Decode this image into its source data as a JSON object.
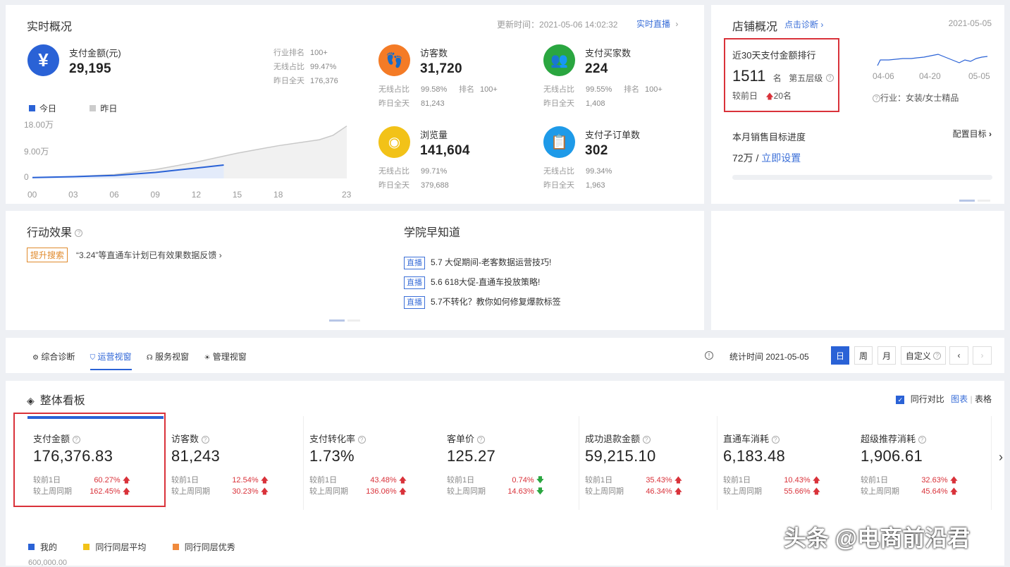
{
  "realtime": {
    "title": "实时概况",
    "updated_label": "更新时间：",
    "updated_time": "2021-05-06 14:02:32",
    "live_link": "实时直播",
    "pay_amount": {
      "label": "支付金额(元)",
      "value": "29,195"
    },
    "stats": [
      {
        "label": "行业排名",
        "value": "100+"
      },
      {
        "label": "无线占比",
        "value": "99.47%"
      },
      {
        "label": "昨日全天",
        "value": "176,376"
      }
    ],
    "legend": {
      "today": "今日",
      "yesterday": "昨日"
    },
    "chart_data": {
      "type": "area",
      "y_ticks": [
        "18.00万",
        "9.00万",
        "0"
      ],
      "x_ticks": [
        "00",
        "03",
        "06",
        "09",
        "12",
        "15",
        "18",
        "23"
      ],
      "series": [
        {
          "name": "今日",
          "x": [
            0,
            3,
            6,
            9,
            12,
            14
          ],
          "values": [
            0.3,
            0.6,
            1.0,
            2.0,
            3.5,
            4.5
          ]
        },
        {
          "name": "昨日",
          "x": [
            0,
            3,
            6,
            9,
            12,
            15,
            18,
            21,
            22,
            23
          ],
          "values": [
            0.3,
            0.6,
            1.3,
            3.0,
            5.5,
            8.5,
            11.0,
            13.0,
            14.5,
            17.6
          ]
        }
      ],
      "ylim": [
        0,
        18
      ]
    },
    "tiles": [
      {
        "icon": "footprint-icon",
        "color": "#f47b26",
        "label": "访客数",
        "value": "31,720",
        "line1_label": "无线占比",
        "line1_value": "99.58%",
        "rank_label": "排名",
        "rank_value": "100+",
        "line2_label": "昨日全天",
        "line2_value": "81,243"
      },
      {
        "icon": "buyer-icon",
        "color": "#2aa640",
        "label": "支付买家数",
        "value": "224",
        "line1_label": "无线占比",
        "line1_value": "99.55%",
        "rank_label": "排名",
        "rank_value": "100+",
        "line2_label": "昨日全天",
        "line2_value": "1,408"
      },
      {
        "icon": "eye-icon",
        "color": "#f2c218",
        "label": "浏览量",
        "value": "141,604",
        "line1_label": "无线占比",
        "line1_value": "99.71%",
        "line2_label": "昨日全天",
        "line2_value": "379,688"
      },
      {
        "icon": "clipboard-icon",
        "color": "#1e9ae8",
        "label": "支付子订单数",
        "value": "302",
        "line1_label": "无线占比",
        "line1_value": "99.34%",
        "line2_label": "昨日全天",
        "line2_value": "1,963"
      }
    ]
  },
  "store": {
    "title": "店铺概况",
    "diag_link": "点击诊断",
    "date": "2021-05-05",
    "rank_title": "近30天支付金额排行",
    "rank_value": "1511",
    "rank_unit": "名",
    "tier": "第五层级",
    "compare_label": "较前日",
    "compare_value": "20名",
    "spark_x": [
      "04-06",
      "04-20",
      "05-05"
    ],
    "industry": "行业：女装/女士精品",
    "target_title": "本月销售目标进度",
    "config_link": "配置目标",
    "target_value": "72万",
    "set_link": "立即设置",
    "target_progress": 0
  },
  "action": {
    "title": "行动效果",
    "tag": "提升搜索",
    "text": "“3.24”等直通车计划已有效果数据反馈"
  },
  "academy": {
    "title": "学院早知道",
    "items": [
      {
        "tag": "直播",
        "text": "5.7 大促期间-老客数据运营技巧!"
      },
      {
        "tag": "直播",
        "text": "5.6 618大促-直通车投放策略!"
      },
      {
        "tag": "直播",
        "text": "5.7不转化？教你如何修复爆款标签"
      }
    ]
  },
  "tabs": {
    "items": [
      {
        "label": "综合诊断",
        "icon": "diagnosis-icon"
      },
      {
        "label": "运营视窗",
        "icon": "shield-icon"
      },
      {
        "label": "服务视窗",
        "icon": "headset-icon"
      },
      {
        "label": "管理视窗",
        "icon": "bulb-icon"
      }
    ],
    "stat_time_label": "统计时间 2021-05-05",
    "periods": [
      "日",
      "周",
      "月"
    ],
    "custom": "自定义"
  },
  "board": {
    "title": "整体看板",
    "peer_compare": "同行对比",
    "view_chart": "图表",
    "view_table": "表格",
    "compare_day": "较前1日",
    "compare_week": "较上周同期",
    "metrics": [
      {
        "label": "支付金额",
        "value": "176,376.83",
        "d": "60.27%",
        "w": "162.45%",
        "d_dir": "up",
        "w_dir": "up"
      },
      {
        "label": "访客数",
        "value": "81,243",
        "d": "12.54%",
        "w": "30.23%",
        "d_dir": "up",
        "w_dir": "up"
      },
      {
        "label": "支付转化率",
        "value": "1.73%",
        "d": "43.48%",
        "w": "136.06%",
        "d_dir": "up",
        "w_dir": "up"
      },
      {
        "label": "客单价",
        "value": "125.27",
        "d": "0.74%",
        "w": "14.63%",
        "d_dir": "down",
        "w_dir": "down"
      },
      {
        "label": "成功退款金额",
        "value": "59,215.10",
        "d": "35.43%",
        "w": "46.34%",
        "d_dir": "up",
        "w_dir": "up"
      },
      {
        "label": "直通车消耗",
        "value": "6,183.48",
        "d": "10.43%",
        "w": "55.66%",
        "d_dir": "up",
        "w_dir": "up"
      },
      {
        "label": "超级推荐消耗",
        "value": "1,906.61",
        "d": "32.63%",
        "w": "45.64%",
        "d_dir": "up",
        "w_dir": "up"
      }
    ],
    "legend": [
      {
        "label": "我的",
        "color": "#2a62d6"
      },
      {
        "label": "同行同层平均",
        "color": "#f2c218"
      },
      {
        "label": "同行同层优秀",
        "color": "#f08a3c"
      }
    ],
    "y_top": "600,000.00"
  },
  "watermark": "头条 @电商前沿君"
}
